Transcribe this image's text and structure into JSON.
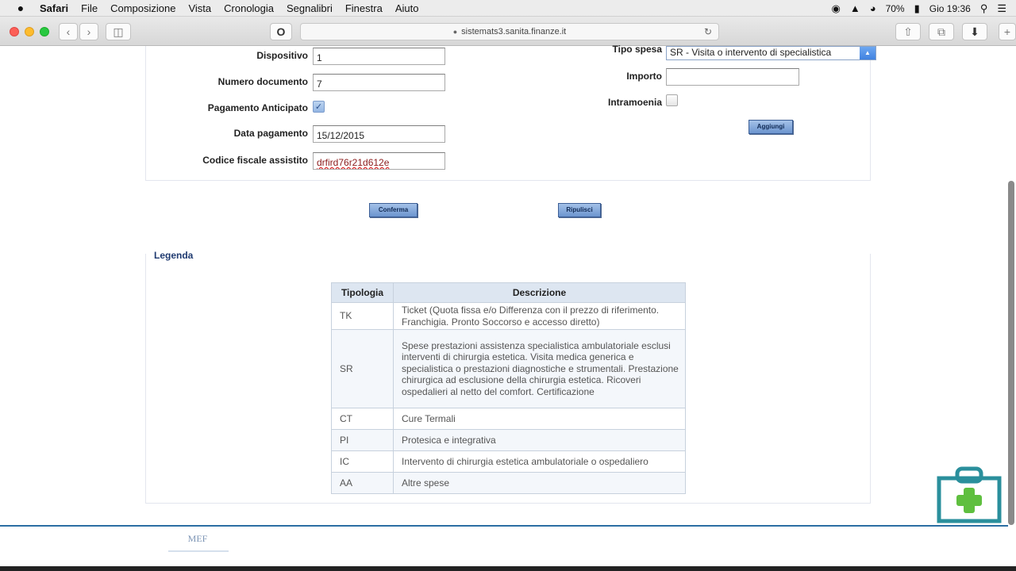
{
  "menubar": {
    "apple": "",
    "items": [
      "Safari",
      "File",
      "Composizione",
      "Vista",
      "Cronologia",
      "Segnalibri",
      "Finestra",
      "Aiuto"
    ],
    "battery": "70%",
    "clock": "Gio 19:36"
  },
  "browser": {
    "url": "sistemats3.sanita.finanze.it",
    "reader_icon": "O"
  },
  "form": {
    "dispositivo_label": "Dispositivo",
    "dispositivo_value": "1",
    "numero_documento_label": "Numero documento",
    "numero_documento_value": "7",
    "pagamento_anticipato_label": "Pagamento Anticipato",
    "pagamento_anticipato_checked": true,
    "data_pagamento_label": "Data pagamento",
    "data_pagamento_value": "15/12/2015",
    "codice_fiscale_label": "Codice fiscale assistito",
    "codice_fiscale_value": "drfird76r21d612e",
    "tipo_spesa_label": "Tipo spesa",
    "tipo_spesa_value": "SR - Visita o intervento di specialistica",
    "importo_label": "Importo",
    "importo_value": "",
    "intramoenia_label": "Intramoenia",
    "intramoenia_checked": false,
    "aggiungi_label": "Aggiungi",
    "conferma_label": "Conferma",
    "ripulisci_label": "Ripulisci"
  },
  "legenda": {
    "title": "Legenda",
    "headers": [
      "Tipologia",
      "Descrizione"
    ],
    "rows": [
      {
        "code": "TK",
        "desc": "Ticket (Quota fissa e/o Differenza con il prezzo di riferimento. Franchigia. Pronto Soccorso e accesso diretto)"
      },
      {
        "code": "SR",
        "desc": "Spese prestazioni assistenza specialistica ambulatoriale esclusi interventi di chirurgia estetica. Visita medica generica e specialistica o prestazioni diagnostiche e strumentali. Prestazione chirurgica ad esclusione della chirurgia estetica. Ricoveri ospedalieri al netto del comfort. Certificazione"
      },
      {
        "code": "CT",
        "desc": "Cure Termali"
      },
      {
        "code": "PI",
        "desc": "Protesica e integrativa"
      },
      {
        "code": "IC",
        "desc": "Intervento di chirurgia estetica ambulatoriale o ospedaliero"
      },
      {
        "code": "AA",
        "desc": "Altre spese"
      }
    ]
  },
  "footer": {
    "logo_text": "MEF"
  },
  "colors": {
    "accent": "#1f3a70",
    "button": "#6c95cf",
    "footer_line": "#2b6ea3",
    "medkit": "#2a8f9c",
    "medkit_cross": "#5fbf3f"
  }
}
